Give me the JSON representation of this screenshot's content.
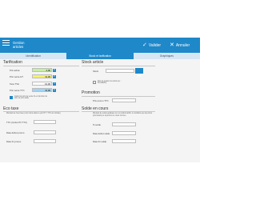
{
  "app": {
    "title_line1": "Gestion",
    "title_line2": "articles"
  },
  "toolbar": {
    "validate_label": "Valider",
    "cancel_label": "Annuler"
  },
  "tabs": [
    {
      "label": "Identification"
    },
    {
      "label": "Stock et tarification"
    },
    {
      "label": "Graphiques"
    }
  ],
  "pricing": {
    "title": "Tarification",
    "prix_achat": {
      "label": "Prix achat",
      "value": "4,00"
    },
    "prix_vente_ht": {
      "label": "Prix vente HT",
      "value": "11,00"
    },
    "taux_tva": {
      "label": "Taux TVA",
      "value": "13,00"
    },
    "prix_vente_ttc": {
      "label": "Prix vente TTC",
      "value": "11,00"
    },
    "auto_calc_label_line1": "Calcul du prix de vente ht en fonction du",
    "auto_calc_label_line2": "taux de prix saisi)"
  },
  "eco": {
    "title": "Eco taxe",
    "note": "Montant de l'éco taxe (non inclus dans le prix HT / TTC de l'article)",
    "ttc_label": "TTC (inclus PV TTC)",
    "date_debut_label": "Date début promo",
    "date_fin_label": "Date fin promo"
  },
  "stock": {
    "title": "Stock article",
    "stock_label": "Stock",
    "no_management_label_line1": "Pas de gestion du stock (ex :",
    "no_management_label_line2": "Prestation)"
  },
  "promotion": {
    "title": "Promotion",
    "price_label": "Prix promo TTC"
  },
  "sales": {
    "title": "Solde en cours",
    "note": "Montant de solde appliqué sur un produit défini, à condition que la promo (promotion) et la promo en cours ont lieu",
    "label_solde": "% solde",
    "label_debut": "Date début solde",
    "label_fin": "Date fin solde"
  },
  "currency_symbol": "€"
}
